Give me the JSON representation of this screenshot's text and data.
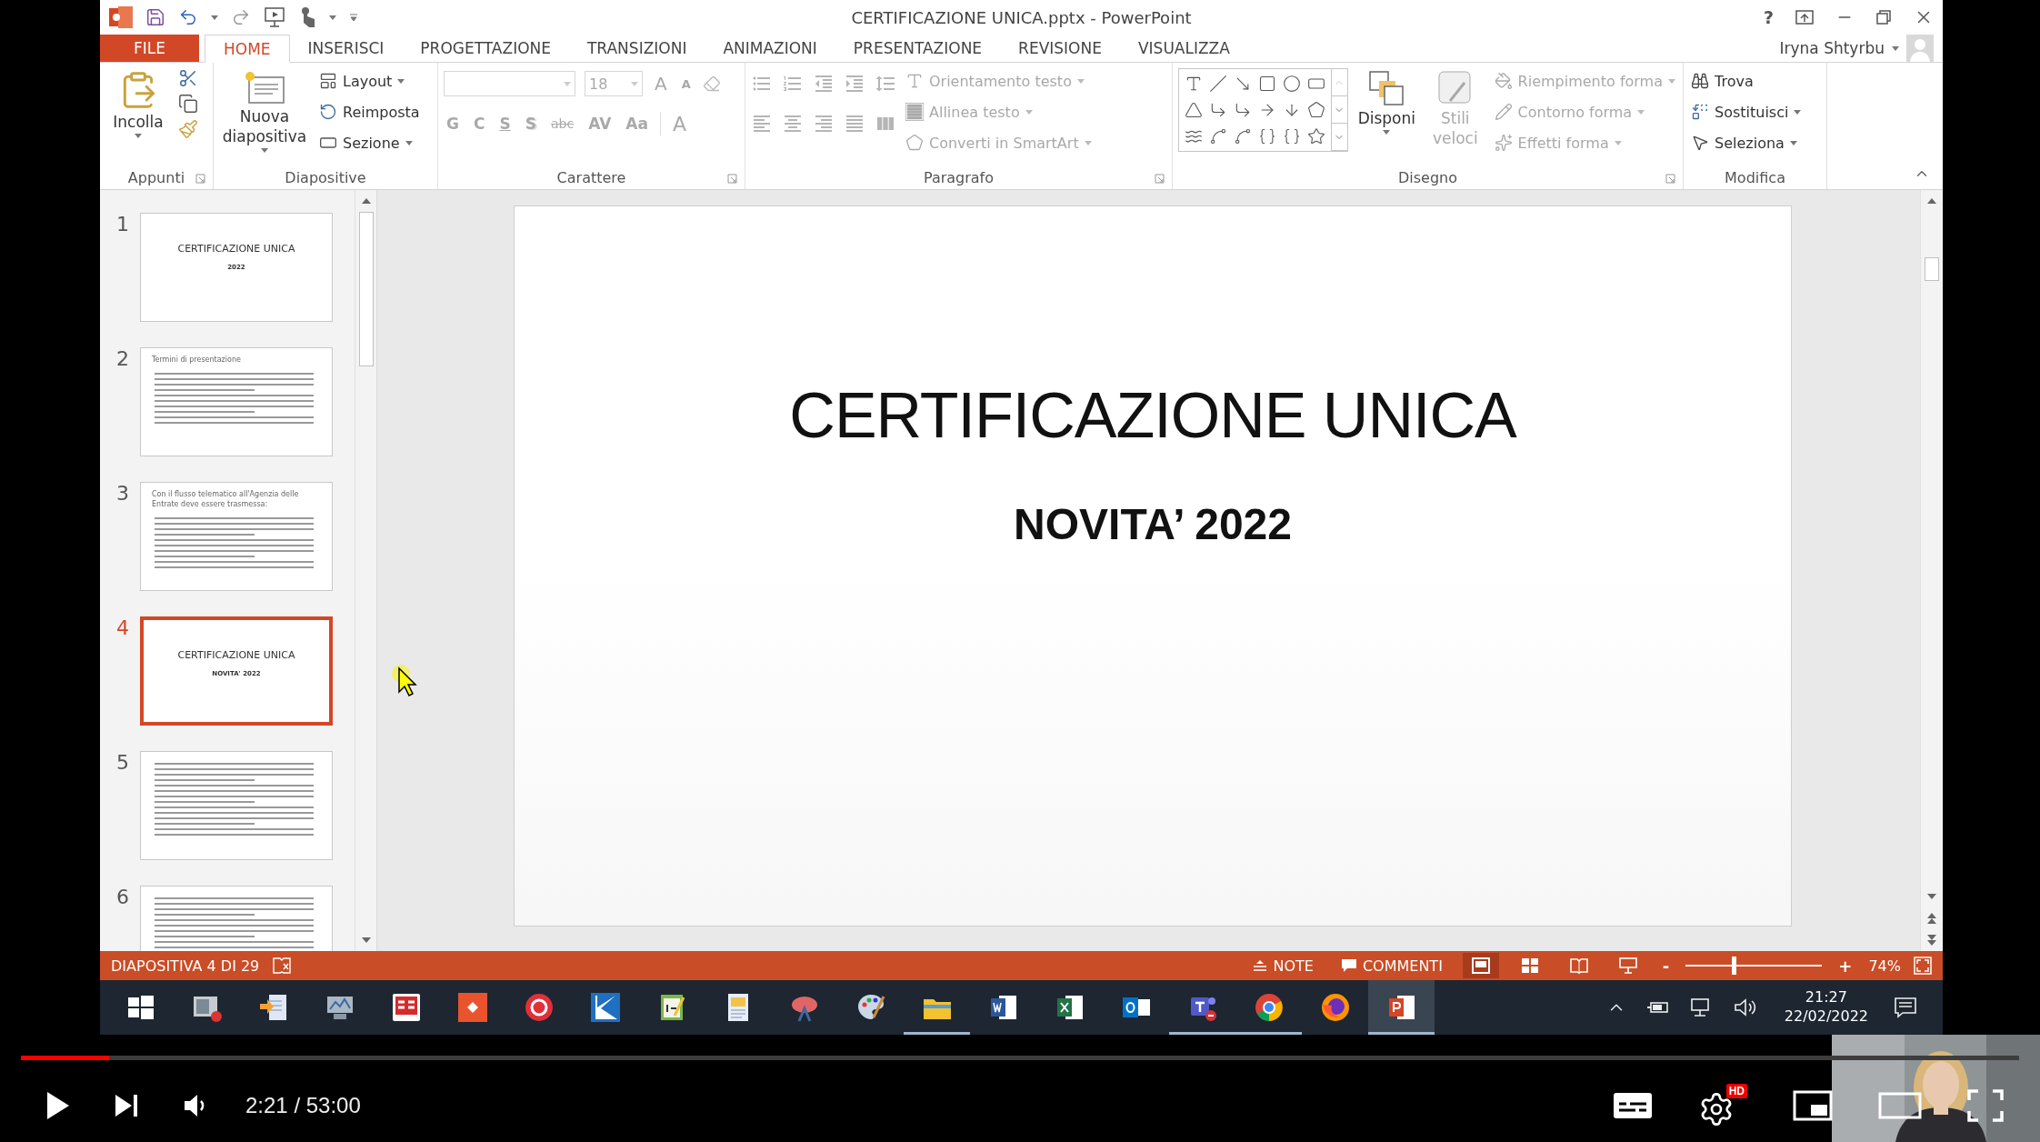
{
  "window": {
    "title": "CERTIFICAZIONE UNICA.pptx - PowerPoint",
    "help": "?"
  },
  "tabs": [
    {
      "label": "FILE",
      "kind": "file",
      "selected": false
    },
    {
      "label": "HOME",
      "kind": "tab",
      "selected": true
    },
    {
      "label": "INSERISCI",
      "kind": "tab",
      "selected": false
    },
    {
      "label": "PROGETTAZIONE",
      "kind": "tab",
      "selected": false
    },
    {
      "label": "TRANSIZIONI",
      "kind": "tab",
      "selected": false
    },
    {
      "label": "ANIMAZIONI",
      "kind": "tab",
      "selected": false
    },
    {
      "label": "PRESENTAZIONE",
      "kind": "tab",
      "selected": false
    },
    {
      "label": "REVISIONE",
      "kind": "tab",
      "selected": false
    },
    {
      "label": "VISUALIZZA",
      "kind": "tab",
      "selected": false
    }
  ],
  "account": {
    "name": "Iryna Shtyrbu"
  },
  "ribbon_groups": [
    {
      "kind": "clipboard",
      "label": "Appunti",
      "items": [
        {
          "label": "Incolla",
          "disabled": false
        }
      ]
    },
    {
      "kind": "slides",
      "label": "Diapositive",
      "items": [
        {
          "label": "Nuova diapositiva",
          "disabled": false
        },
        {
          "label": "Layout",
          "disabled": false
        },
        {
          "label": "Reimposta",
          "disabled": false
        },
        {
          "label": "Sezione",
          "disabled": false
        }
      ]
    },
    {
      "kind": "font",
      "label": "Carattere",
      "font_size": "18",
      "items": [
        {
          "label": "A",
          "kind": "grow",
          "disabled": true
        },
        {
          "label": "A",
          "kind": "shrink",
          "disabled": true
        },
        {
          "label": "G",
          "kind": "bold",
          "disabled": true
        },
        {
          "label": "C",
          "kind": "italic",
          "disabled": true
        },
        {
          "label": "S",
          "kind": "underline",
          "disabled": true
        },
        {
          "label": "S",
          "kind": "shadow",
          "disabled": true
        },
        {
          "label": "abc",
          "kind": "strike",
          "disabled": true
        },
        {
          "label": "AV",
          "kind": "spacing",
          "disabled": true
        },
        {
          "label": "Aa",
          "kind": "case",
          "disabled": true
        },
        {
          "label": "A",
          "kind": "color",
          "disabled": true
        }
      ]
    },
    {
      "kind": "paragraph",
      "label": "Paragrafo",
      "items": [
        {
          "label": "Orientamento testo",
          "disabled": true
        },
        {
          "label": "Allinea testo",
          "disabled": true
        },
        {
          "label": "Converti in SmartArt",
          "disabled": true
        }
      ]
    },
    {
      "kind": "drawing",
      "label": "Disegno",
      "items": [
        {
          "label": "Disponi",
          "disabled": false
        },
        {
          "label": "Stili veloci",
          "disabled": true
        },
        {
          "label": "Riempimento forma",
          "disabled": true
        },
        {
          "label": "Contorno forma",
          "disabled": true
        },
        {
          "label": "Effetti forma",
          "disabled": true
        }
      ]
    },
    {
      "kind": "editing",
      "label": "Modifica",
      "items": [
        {
          "label": "Trova",
          "disabled": false
        },
        {
          "label": "Sostituisci",
          "disabled": false
        },
        {
          "label": "Seleziona",
          "disabled": false
        }
      ]
    }
  ],
  "thumbnails": [
    {
      "number": "1",
      "kind": "title",
      "title": "CERTIFICAZIONE UNICA",
      "subtitle": "2022",
      "selected": false
    },
    {
      "number": "2",
      "kind": "text",
      "heading": "Termini di presentazione",
      "selected": false
    },
    {
      "number": "3",
      "kind": "text",
      "heading": "Con il flusso telematico all'Agenzia delle Entrate deve essere trasmessa:",
      "selected": false
    },
    {
      "number": "4",
      "kind": "title",
      "title": "CERTIFICAZIONE UNICA",
      "subtitle": "NOVITA' 2022",
      "selected": true
    },
    {
      "number": "5",
      "kind": "text",
      "selected": false
    },
    {
      "number": "6",
      "kind": "text",
      "selected": false
    }
  ],
  "slide": {
    "title": "CERTIFICAZIONE UNICA",
    "subtitle": "NOVITA’ 2022"
  },
  "status_bar": {
    "slide_info": "DIAPOSITIVA 4 DI 29",
    "notes": "NOTE",
    "comments": "COMMENTI",
    "views": [
      {
        "kind": "normal",
        "selected": true
      },
      {
        "kind": "sorter",
        "selected": false
      },
      {
        "kind": "reading",
        "selected": false
      },
      {
        "kind": "slideshow",
        "selected": false
      }
    ],
    "zoom_out": "-",
    "zoom_in": "+",
    "zoom": {
      "level": 0.35
    },
    "zoom_reading": "74%"
  },
  "taskbar": {
    "apps": [
      {
        "kind": "start",
        "running": false,
        "active": false
      },
      {
        "kind": "recorder",
        "running": false,
        "active": false
      },
      {
        "kind": "transfer",
        "running": false,
        "active": false
      },
      {
        "kind": "monitor",
        "running": false,
        "active": false
      },
      {
        "kind": "redlogo",
        "running": false,
        "active": false
      },
      {
        "kind": "diamond",
        "running": false,
        "active": false
      },
      {
        "kind": "ring",
        "running": false,
        "active": false
      },
      {
        "kind": "klogo",
        "running": false,
        "active": false
      },
      {
        "kind": "notepad",
        "running": false,
        "active": false
      },
      {
        "kind": "document",
        "running": false,
        "active": false
      },
      {
        "kind": "snipping",
        "running": false,
        "active": false
      },
      {
        "kind": "paint",
        "running": false,
        "active": false
      },
      {
        "kind": "folder",
        "running": true,
        "active": false
      },
      {
        "kind": "word",
        "running": false,
        "active": false
      },
      {
        "kind": "excel",
        "running": false,
        "active": false
      },
      {
        "kind": "outlook",
        "running": false,
        "active": false
      },
      {
        "kind": "teams",
        "running": true,
        "active": false
      },
      {
        "kind": "chrome",
        "running": true,
        "active": false
      },
      {
        "kind": "firefox",
        "running": false,
        "active": false
      },
      {
        "kind": "powerpoint",
        "running": true,
        "active": true
      }
    ],
    "clock": {
      "time": "21:27",
      "date": "22/02/2022"
    }
  },
  "player": {
    "progress": {
      "level": 0.044
    },
    "time": "2:21 / 53:00",
    "hd_badge": "HD"
  }
}
